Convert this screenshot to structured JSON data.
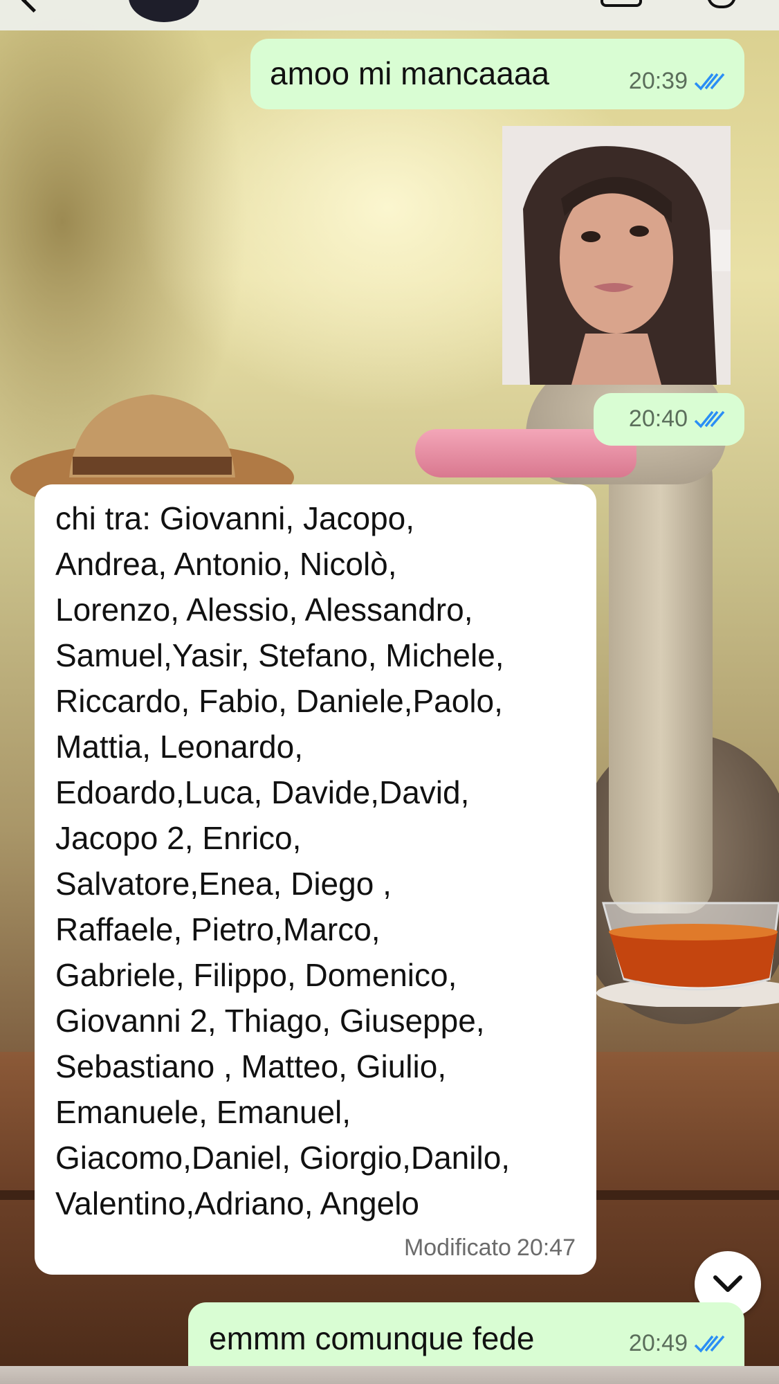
{
  "messages": [
    {
      "direction": "outgoing",
      "type": "text",
      "text": "amoo mi mancaaaa",
      "time": "20:39",
      "read": true
    },
    {
      "direction": "outgoing",
      "type": "image",
      "time": "20:40",
      "read": true
    },
    {
      "direction": "incoming",
      "type": "text",
      "edited_label": "Modificato",
      "time": "20:47",
      "lines": [
        "chi tra: Giovanni, Jacopo,",
        "Andrea, Antonio, Nicolò,",
        "Lorenzo, Alessio, Alessandro,",
        "Samuel,Yasir, Stefano, Michele,",
        "Riccardo, Fabio, Daniele,Paolo,",
        "Mattia, Leonardo,",
        "Edoardo,Luca, Davide,David,",
        "Jacopo 2, Enrico,",
        "Salvatore,Enea, Diego ,",
        "Raffaele, Pietro,Marco,",
        "Gabriele, Filippo, Domenico,",
        "Giovanni 2, Thiago, Giuseppe,",
        "Sebastiano , Matteo, Giulio,",
        "Emanuele, Emanuel,",
        "Giacomo,Daniel, Giorgio,Danilo,",
        "Valentino,Adriano, Angelo"
      ]
    },
    {
      "direction": "outgoing",
      "type": "text",
      "text": "emmm comunque fede",
      "time": "20:49",
      "read": true
    }
  ],
  "icons": {
    "read_ticks": "double-check-icon",
    "scroll_down": "chevron-down-icon"
  },
  "colors": {
    "outgoing_bubble": "#d9fdd3",
    "incoming_bubble": "#ffffff",
    "read_ticks": "#2a8ef5"
  }
}
